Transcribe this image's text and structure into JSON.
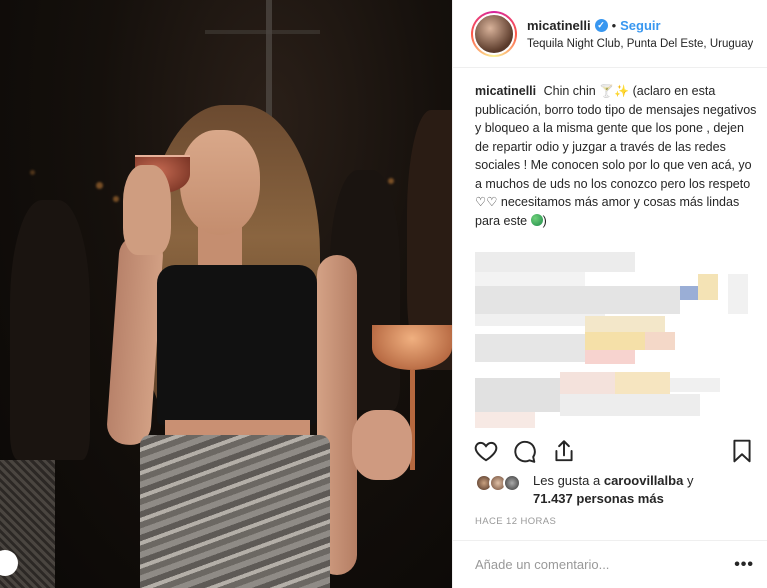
{
  "post": {
    "image_alt": "Woman holding a cocktail glass at a night club",
    "header": {
      "username": "micatinelli",
      "separator": "•",
      "follow_label": "Seguir",
      "location": "Tequila Night Club, Punta Del Este, Uruguay"
    },
    "caption": {
      "username": "micatinelli",
      "text_part1": "Chin chin",
      "text_part2": "(aclaro en esta publicación, borro todo tipo de mensajes negativos y bloqueo a la misma gente que los pone , dejen de repartir odio y juzgar a través de las redes sociales ! Me conocen solo por lo que ven acá, yo a muchos de uds no los conozco pero los respeto",
      "heart_glyphs": "♡♡",
      "text_part3": "necesitamos más amor y cosas más lindas para este",
      "text_end": ")"
    },
    "likes": {
      "prefix": "Les gusta a",
      "user": "caroovillalba",
      "conjunction": "y",
      "count_text": "71.437 personas más"
    },
    "timestamp": "HACE 12 HORAS",
    "comment": {
      "placeholder": "Añade un comentario...",
      "more_label": "•••"
    },
    "icons": {
      "like": "heart-icon",
      "comment": "comment-icon",
      "share": "share-icon",
      "save": "bookmark-icon",
      "verified": "verified-badge-icon"
    },
    "colors": {
      "link_blue": "#3897f0",
      "text": "#262626",
      "muted": "#999999"
    }
  }
}
